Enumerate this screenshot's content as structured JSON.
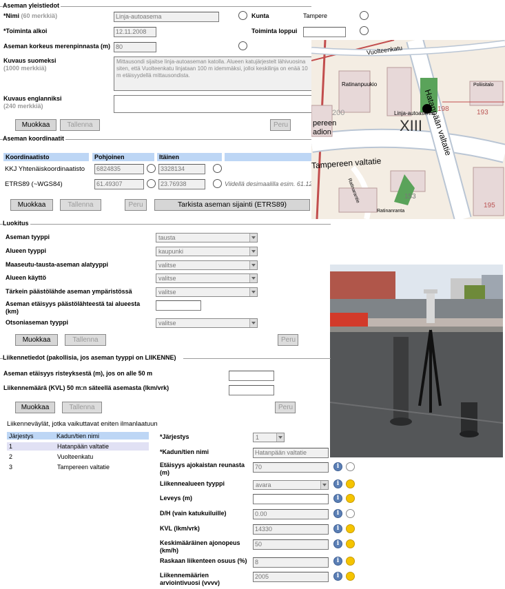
{
  "general": {
    "legend": "Aseman yleistiedot",
    "name_label": "*Nimi",
    "name_hint": "(60 merkkiä)",
    "name_value": "Linja-autoasema",
    "municipality_label": "Kunta",
    "municipality_value": "Tampere",
    "start_label": "*Toiminta alkoi",
    "start_value": "12.11.2008",
    "end_label": "Toiminta loppui",
    "end_value": "",
    "altitude_label": "Aseman korkeus merenpinnasta (m)",
    "altitude_value": "80",
    "desc_fi_label": "Kuvaus suomeksi",
    "desc_fi_hint": "(1000 merkkiä)",
    "desc_fi_value": "Mittausondi sijaitse linja-autoaseman katolla. Alueen katujärjestelt lähivuosina siten, että Vuolteenkatu linjataan 100 m idemmäksi, jolloi keskilinja on enää 10 m etäisyydellä mittausondista.",
    "desc_en_label": "Kuvaus englanniksi",
    "desc_en_hint": "(240 merkkiä)",
    "desc_en_value": "",
    "edit": "Muokkaa",
    "save": "Tallenna",
    "cancel": "Peru"
  },
  "coords": {
    "legend": "Aseman koordinaatit",
    "headers": [
      "Koordinaatisto",
      "Pohjoinen",
      "Itäinen",
      ""
    ],
    "rows": [
      {
        "system": "KKJ Yhtenäiskoordinaatisto",
        "north": "6824835",
        "east": "3328134",
        "note": ""
      },
      {
        "system": "ETRS89 (~WGS84)",
        "north": "61.49307",
        "east": "23.76938",
        "note": "Viidellä desimaalilla esim. 61.12"
      }
    ],
    "edit": "Muokkaa",
    "save": "Tallenna",
    "cancel": "Peru",
    "check": "Tarkista aseman sijainti (ETRS89)"
  },
  "map": {
    "streets": [
      "Vuolteenkatu",
      "Hatanpään valtatie",
      "Ratinanpuukio",
      "Linja-autoasema",
      "Tampereen valtatie",
      "pereen",
      "adion",
      "Ratinarantie",
      "Ratinanranta",
      "Poliisitalo",
      "XIII"
    ],
    "numbers": [
      "200",
      "198",
      "193",
      "195",
      "153"
    ]
  },
  "classification": {
    "legend": "Luokitus",
    "rows": [
      {
        "label": "Aseman tyyppi",
        "value": "tausta",
        "type": "select"
      },
      {
        "label": "Alueen tyyppi",
        "value": "kaupunki",
        "type": "select"
      },
      {
        "label": "Maaseutu-tausta-aseman alatyyppi",
        "value": "valitse",
        "type": "select"
      },
      {
        "label": "Alueen käyttö",
        "value": "valitse",
        "type": "select"
      },
      {
        "label": "Tärkein päästölähde aseman ympäristössä",
        "value": "valitse",
        "type": "select"
      },
      {
        "label": "Aseman etäisyys päästölähteestä tai alueesta (km)",
        "value": "",
        "type": "input"
      },
      {
        "label": "Otsoniaseman tyyppi",
        "value": "valitse",
        "type": "select"
      }
    ],
    "edit": "Muokkaa",
    "save": "Tallenna",
    "cancel": "Peru"
  },
  "traffic": {
    "legend": "Liikennetiedot (pakollisia, jos aseman tyyppi on LIIKENNE)",
    "distance_label": "Aseman etäisyys risteyksestä (m), jos on alle 50 m",
    "kvl_label": "Liikennemäärä (KVL) 50 m:n säteellä asemasta (lkm/vrk)",
    "edit": "Muokkaa",
    "save": "Tallenna",
    "cancel": "Peru",
    "roads_title": "Liikenneväylät, jotka vaikuttavat eniten ilmanlaatuun",
    "roads_headers": [
      "Järjestys",
      "Kadun/tien nimi"
    ],
    "roads": [
      {
        "order": "1",
        "name": "Hatanpään valtatie"
      },
      {
        "order": "2",
        "name": "Vuolteenkatu"
      },
      {
        "order": "3",
        "name": "Tampereen valtatie"
      }
    ],
    "detail": [
      {
        "label": "*Järjestys",
        "value": "1",
        "type": "select",
        "info": false,
        "status": ""
      },
      {
        "label": "*Kadun/tien nimi",
        "value": "Hatanpään valtatie",
        "type": "input",
        "info": false,
        "status": ""
      },
      {
        "label": "Etäisyys ajokaistan reunasta (m)",
        "value": "70",
        "type": "input",
        "info": true,
        "status": "off"
      },
      {
        "label": "Liikennealueen tyyppi",
        "value": "avara",
        "type": "select",
        "info": true,
        "status": "on"
      },
      {
        "label": "Leveys (m)",
        "value": "",
        "type": "input-white",
        "info": true,
        "status": "on"
      },
      {
        "label": "D/H (vain katukuiluille)",
        "value": "0.00",
        "type": "input",
        "info": true,
        "status": "off"
      },
      {
        "label": "KVL (lkm/vrk)",
        "value": "14330",
        "type": "input",
        "info": true,
        "status": "on"
      },
      {
        "label": "Keskimääräinen ajonopeus (km/h)",
        "value": "50",
        "type": "input",
        "info": true,
        "status": "on"
      },
      {
        "label": "Raskaan liikenteen osuus (%)",
        "value": "8",
        "type": "input",
        "info": true,
        "status": "on"
      },
      {
        "label": "Liikennemäärien arviointivuosi (vvvv)",
        "value": "2005",
        "type": "input",
        "info": true,
        "status": "on"
      }
    ]
  }
}
